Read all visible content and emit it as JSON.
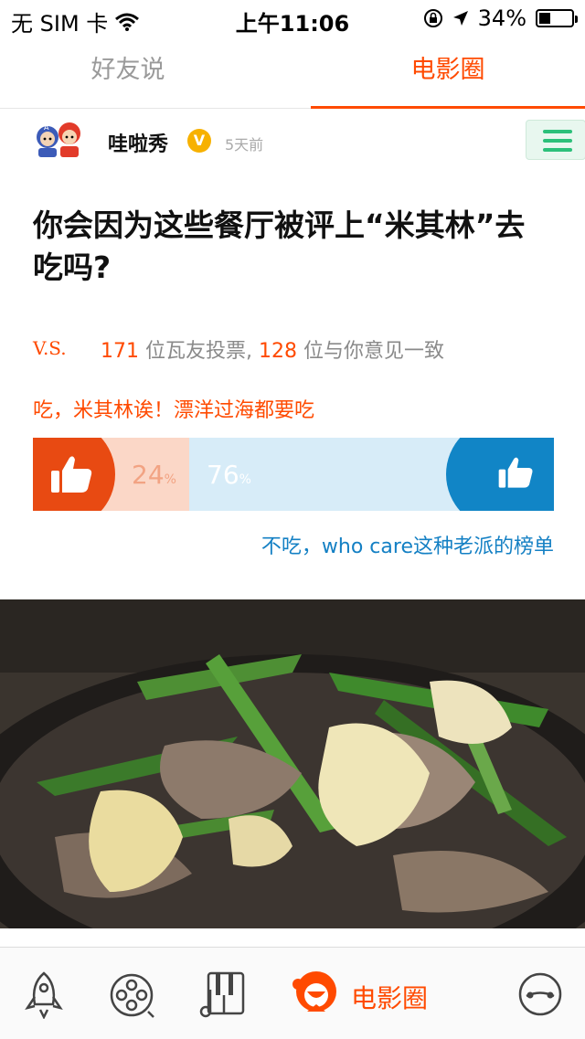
{
  "status_bar": {
    "carrier": "无 SIM 卡",
    "time": "上午11:06",
    "battery": "34%",
    "battery_level": 0.34
  },
  "tabs": [
    {
      "label": "好友说",
      "active": false
    },
    {
      "label": "电影圈",
      "active": true
    }
  ],
  "post": {
    "author": "哇啦秀",
    "verified_badge": "V",
    "time_ago": "5天前",
    "title": "你会因为这些餐厅被评上“米其林”去吃吗?",
    "vs_label": "V.S.",
    "voters": "171",
    "voters_suffix": " 位瓦友投票, ",
    "agree": "128",
    "agree_suffix": " 位与你意见一致",
    "option_a": "吃，米其林诶！漂洋过海都要吃",
    "option_b": "不吃，who care这种老派的榜单",
    "percent_a": "24",
    "percent_b": "76",
    "percent_unit": "%"
  },
  "bottom_nav": {
    "active_label": "电影圈",
    "icons": [
      "rocket-icon",
      "film-reel-icon",
      "piano-music-icon",
      "mascot-icon",
      "profile-face-icon"
    ]
  },
  "colors": {
    "accent": "#ff4a00",
    "blue": "#1480c4",
    "vote_a": "#e84a12",
    "vote_b": "#1185c6",
    "green": "#2cc07a"
  }
}
